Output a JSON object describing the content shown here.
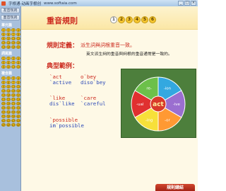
{
  "window": {
    "title": "字根通-动画字根创",
    "url": "www.softaia.com",
    "controls": [
      "_",
      "□",
      "×"
    ]
  },
  "sidebar": {
    "buttons": [
      {
        "label": "发音规则"
      },
      {
        "label": "重音规则"
      }
    ],
    "sections": [
      {
        "label": "單元篇",
        "numbers": [
          "1",
          "2",
          "3",
          "4",
          "5",
          "6",
          "7",
          "8",
          "9",
          "10",
          "11",
          "12",
          "13",
          "14",
          "15",
          "16",
          "17",
          "18",
          "19",
          "20"
        ]
      },
      {
        "label": "詞尾篇",
        "numbers": [
          "1",
          "2",
          "3",
          "4",
          "5",
          "6",
          "7",
          "8",
          "9",
          "10",
          "11",
          "12"
        ]
      },
      {
        "label": "複合篇",
        "numbers": [
          "1",
          "2",
          "3",
          "4",
          "5",
          "6",
          "7",
          "8",
          "9",
          "10",
          "11",
          "12",
          "13",
          "14",
          "15",
          "16",
          "17",
          "18",
          "19",
          "20",
          "21",
          "22",
          "23",
          "24",
          "25",
          "26",
          "27",
          "28",
          "29",
          "30",
          "31",
          "32",
          "33",
          "34",
          "35",
          "36",
          "37",
          "38",
          "39",
          "40",
          "41",
          "42",
          "43",
          "44",
          "45",
          "46",
          "47",
          "48"
        ]
      }
    ]
  },
  "header": {
    "title": "重音規則",
    "pages": [
      "1",
      "2",
      "3",
      "4",
      "5",
      "6"
    ],
    "active_page": "1"
  },
  "definition": {
    "label": "規則定義：",
    "text": "派生詞與詞根重音一致。",
    "note": "英文派生詞的重音與詞根的重音通常是一致的。"
  },
  "examples": {
    "label": "典型範例：",
    "pairs": [
      {
        "root": "`act",
        "derived": "`active"
      },
      {
        "root": "o`bey",
        "derived": "diso`bey"
      },
      {
        "root": "`like",
        "derived": "dis`like"
      },
      {
        "root": "`care",
        "derived": "`careful"
      },
      {
        "root": "`possible",
        "derived": "im`possible"
      }
    ]
  },
  "wheel": {
    "center": "act",
    "segments": [
      {
        "label": "-ion",
        "color": "#33a8e0"
      },
      {
        "label": "-ive",
        "color": "#9b6fd0"
      },
      {
        "label": "-or",
        "color": "#ff9933"
      },
      {
        "label": "-ing",
        "color": "#f7e03a"
      },
      {
        "label": "-ual",
        "color": "#e03030"
      },
      {
        "label": "re-",
        "color": "#6cc04a"
      }
    ]
  },
  "footer": {
    "button_label": "規則總結"
  }
}
